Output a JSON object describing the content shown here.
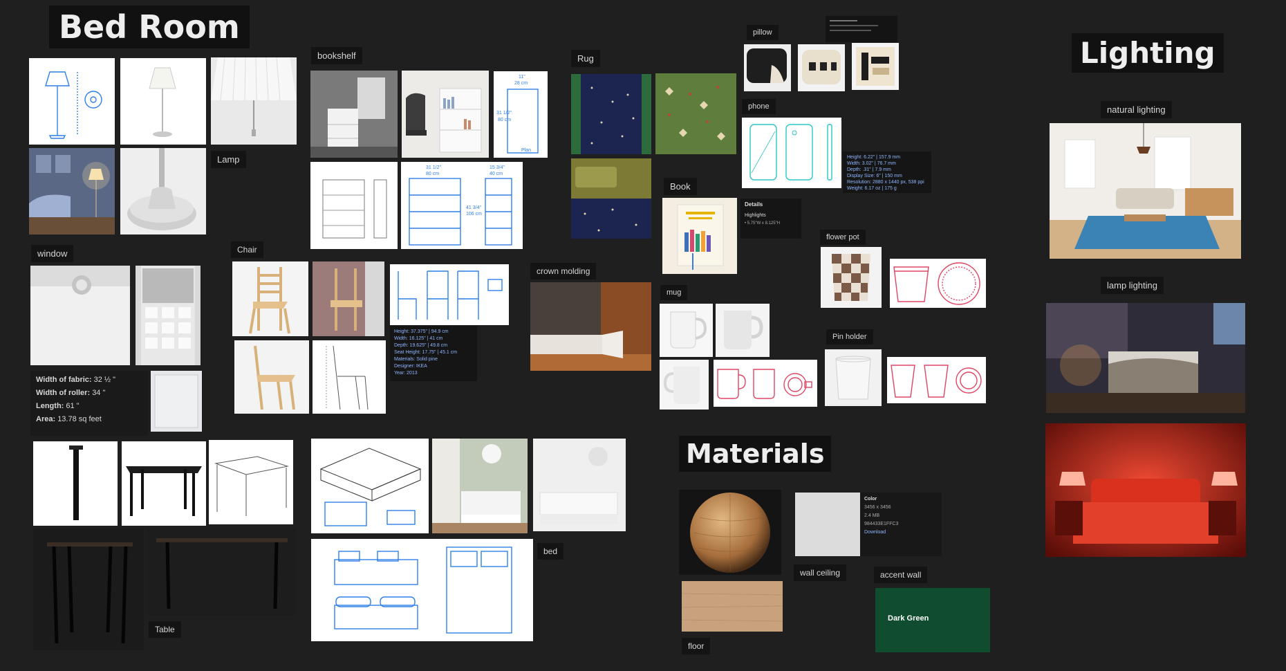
{
  "board": {
    "heading_bedroom": "Bed Room",
    "heading_lighting": "Lighting",
    "heading_materials": "Materials"
  },
  "labels": {
    "lamp": "Lamp",
    "bookshelf": "bookshelf",
    "rug": "Rug",
    "pillow": "pillow",
    "phone": "phone",
    "book": "Book",
    "flower_pot": "flower pot",
    "window": "window",
    "chair": "Chair",
    "crown_molding": "crown molding",
    "mug": "mug",
    "pin_holder": "Pin holder",
    "table": "Table",
    "bed": "bed",
    "wall_ceiling": "wall ceiling",
    "accent_wall": "accent wall",
    "floor": "floor",
    "natural_lighting": "natural lighting",
    "lamp_lighting": "lamp lighting"
  },
  "window_specs": {
    "fabric_label": "Width of fabric:",
    "fabric_value": "32 ½ \"",
    "roller_label": "Width of roller:",
    "roller_value": "34 \"",
    "length_label": "Length:",
    "length_value": "61 \"",
    "area_label": "Area:",
    "area_value": "13.78 sq feet"
  },
  "chair_specs": {
    "height": "Height: 37.375\" | 94.9 cm",
    "width": "Width: 16.125\" | 41 cm",
    "depth": "Depth: 19.625\" | 49.8 cm",
    "seat": "Seat Height: 17.75\" | 45.1 cm",
    "materials": "Materials: Solid pine",
    "designer": "Designer: IKEA",
    "year": "Year: 2013"
  },
  "phone_specs": {
    "height": "Height: 6.22\" | 157.9 mm",
    "width": "Width: 3.02\" | 76.7 mm",
    "depth": "Depth: .31\" | 7.9 mm",
    "display": "Display Size: 6\" | 150 mm",
    "resolution": "Resolution: 2880 x 1440 px, 538 ppi",
    "weight": "Weight: 6.17 oz | 175 g"
  },
  "book_details": {
    "title": "Details",
    "highlights": "Highlights",
    "size": "5.75\"W x 8.125\"H"
  },
  "bookshelf_dims": {
    "plan_w1": "11\"",
    "plan_w2": "28 cm",
    "plan_h1": "31 1/2\"",
    "plan_h2": "80 cm",
    "plan_label": "Plan",
    "front_w1": "31 1/2\"",
    "front_w2": "80 cm",
    "side_w1": "15 3/4\"",
    "side_w2": "40 cm",
    "h1": "41 3/4\"",
    "h2": "106 cm"
  },
  "material_color": {
    "title": "Color",
    "size": "3456 x 3456",
    "file": "2.4 MB",
    "code": "984433E1FFC3",
    "download": "Download"
  },
  "accent": {
    "name": "Dark Green",
    "color": "#0f4d2e"
  },
  "colors": {
    "background": "#1f1f1f",
    "blueprint": "#2f7fe8",
    "mug_lines": "#e04563"
  }
}
